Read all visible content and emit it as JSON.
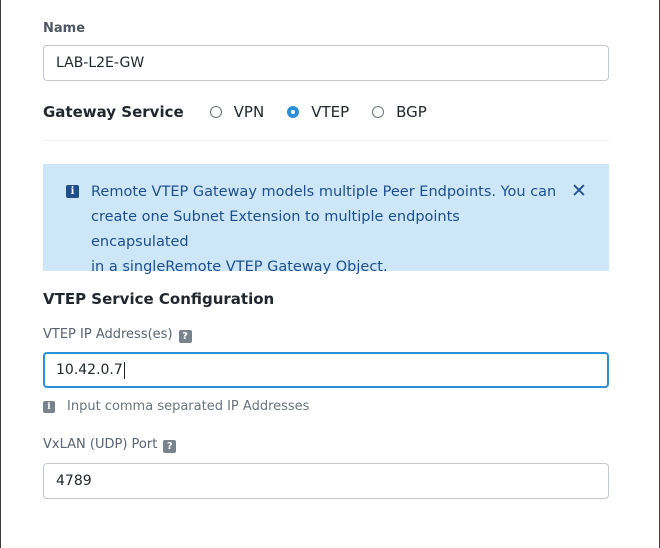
{
  "name_field": {
    "label": "Name",
    "value": "LAB-L2E-GW"
  },
  "gateway_service": {
    "label": "Gateway Service",
    "options": [
      {
        "label": "VPN",
        "selected": false
      },
      {
        "label": "VTEP",
        "selected": true
      },
      {
        "label": "BGP",
        "selected": false
      }
    ]
  },
  "info_banner": {
    "lines": [
      "Remote VTEP Gateway models multiple Peer Endpoints. You can",
      "create one Subnet Extension to multiple endpoints encapsulated",
      "in a singleRemote VTEP Gateway Object."
    ],
    "icon": "info-icon",
    "close_icon": "close-icon"
  },
  "vtep_config": {
    "title": "VTEP Service Configuration",
    "ip_field": {
      "label": "VTEP IP Address(es)",
      "value": "10.42.0.7",
      "hint": "Input comma separated IP Addresses"
    },
    "port_field": {
      "label": "VxLAN (UDP) Port",
      "value": "4789"
    }
  },
  "colors": {
    "accent": "#2c8fd8",
    "banner_bg": "#cde6f8",
    "banner_text": "#1f4e8c"
  }
}
